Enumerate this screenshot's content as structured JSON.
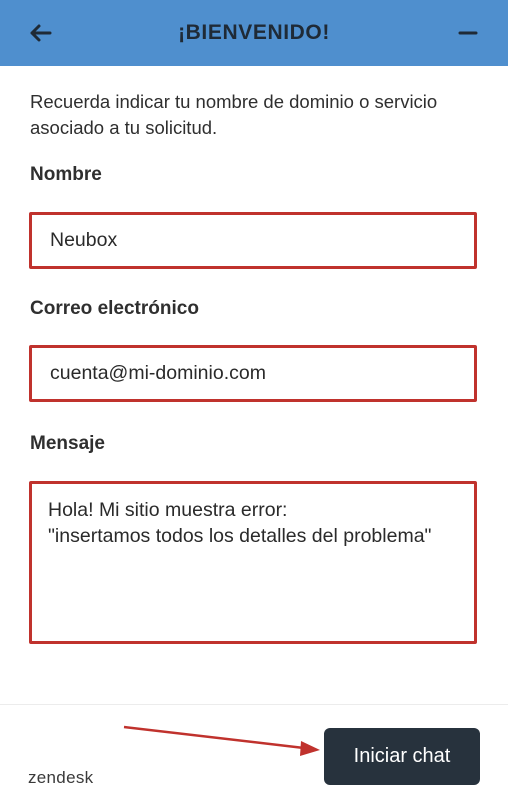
{
  "header": {
    "title": "¡BIENVENIDO!",
    "back_icon": "arrow-left-icon",
    "minimize_icon": "minus-icon",
    "background": "#4f8fce"
  },
  "intro_text": "Recuerda indicar tu nombre de dominio o servicio asociado a tu solicitud.",
  "form": {
    "name": {
      "label": "Nombre",
      "value": "Neubox"
    },
    "email": {
      "label": "Correo electrónico",
      "value": "cuenta@mi-dominio.com"
    },
    "message": {
      "label": "Mensaje",
      "value": "Hola! Mi sitio muestra error:\n\"insertamos todos los detalles del problema\""
    },
    "highlight_color": "#c0322d"
  },
  "footer": {
    "brand": "zendesk",
    "start_button_label": "Iniciar chat",
    "button_color": "#27323d"
  },
  "annotation": {
    "arrow_icon": "red-arrow-pointer",
    "color": "#c0322d"
  }
}
